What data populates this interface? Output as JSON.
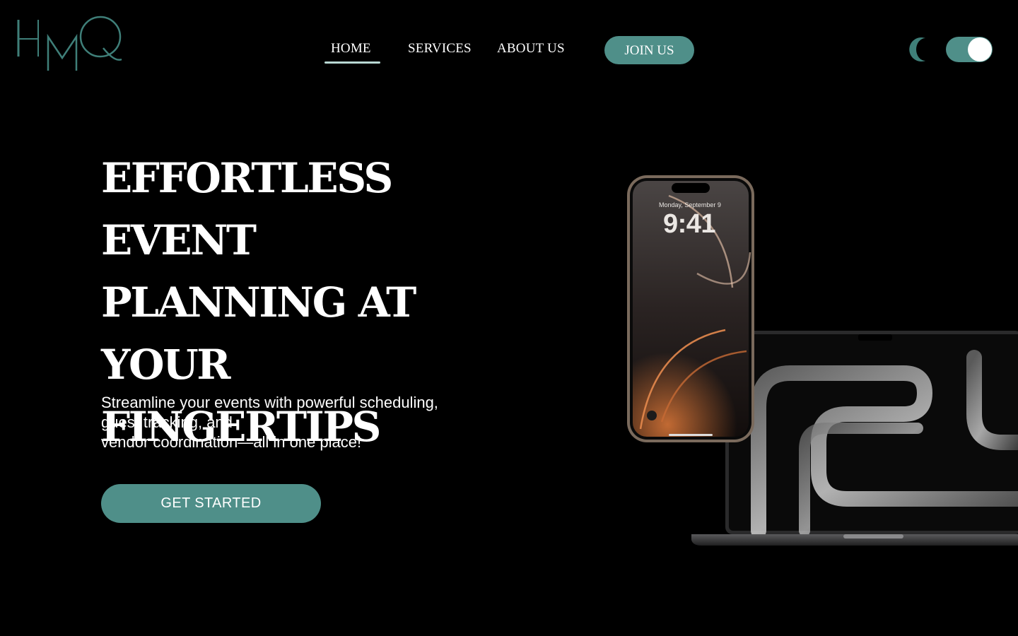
{
  "brand": {
    "logo_text": "HMQ",
    "accent_color": "#4f8f89",
    "logo_color": "#3f7f79"
  },
  "nav": {
    "items": [
      {
        "label": "HOME",
        "active": true
      },
      {
        "label": "SERVICES",
        "active": false
      },
      {
        "label": "ABOUT US",
        "active": false
      }
    ],
    "join_label": "JOIN US"
  },
  "theme": {
    "mode_icon": "moon-icon",
    "toggle_state": "on"
  },
  "hero": {
    "title_lines": [
      "EFFORTLESS EVENT",
      "PLANNING AT YOUR",
      "FINGERTIPS"
    ],
    "subtitle_lines": [
      "Streamline your events with powerful scheduling,",
      "guest tracking, and",
      "vendor coordination—all in one place!"
    ],
    "cta_label": "GET STARTED"
  },
  "devices": {
    "phone": {
      "date": "Monday, September 9",
      "time": "9:41"
    },
    "laptop_icon": "laptop-image"
  }
}
